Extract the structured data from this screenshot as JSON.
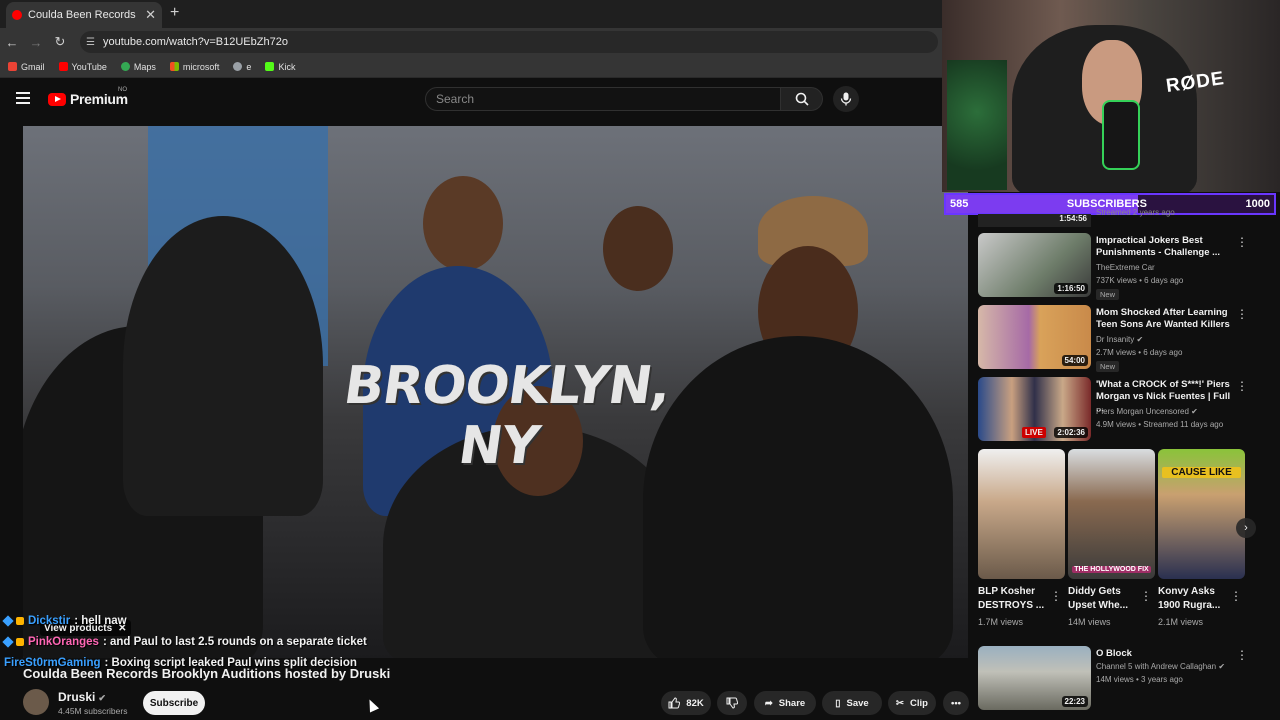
{
  "browser": {
    "tab_title": "Coulda Been Records Brook",
    "url": "youtube.com/watch?v=B12UEbZh72o",
    "bookmarks": [
      "Gmail",
      "YouTube",
      "Maps",
      "microsoft",
      "e",
      "Kick"
    ]
  },
  "header": {
    "logo_text": "Premium",
    "region": "NO",
    "search_placeholder": "Search"
  },
  "video": {
    "overlay_text": "BROOKLYN, NY",
    "title": "Coulda Been Records Brooklyn Auditions hosted by Druski",
    "channel": "Druski",
    "subscribers": "4.45M subscribers",
    "subscribe_label": "Subscribe",
    "likes": "82K",
    "share_label": "Share",
    "save_label": "Save",
    "clip_label": "Clip",
    "view_products_label": "View products"
  },
  "chat": [
    {
      "user": "Dickstir",
      "user_color": "#3aa0ff",
      "message": ": hell naw"
    },
    {
      "user": "PinkOranges",
      "user_color": "#ff66b4",
      "message": ": and Paul to last 2.5 rounds on a separate ticket"
    },
    {
      "user": "FireSt0rmGaming",
      "user_color": "#3aa0ff",
      "message": ": Boxing script leaked Paul wins split decision"
    }
  ],
  "stream": {
    "mic_brand": "RØDE",
    "goal_current": "585",
    "goal_label": "SUBSCRIBERS",
    "goal_target": "1000",
    "goal_fraction": 0.585
  },
  "sidebar": {
    "partial_duration": "1:54:56",
    "partial_meta": "Streamed 2 years ago",
    "videos": [
      {
        "title": "Impractical Jokers Best Punishments - Challenge ...",
        "channel": "TheExtreme Car",
        "meta": "737K views • 6 days ago",
        "badge": "New",
        "duration": "1:16:50"
      },
      {
        "title": "Mom Shocked After Learning Teen Sons Are Wanted Killers",
        "channel": "Dr Insanity",
        "meta": "2.7M views • 6 days ago",
        "badge": "New",
        "duration": "54:00"
      },
      {
        "title": "'What a CROCK of S***!' Piers Morgan vs Nick Fuentes | Full ...",
        "channel": "Piers Morgan Uncensored",
        "meta": "4.9M views • Streamed 11 days ago",
        "live": "LIVE",
        "duration": "2:02:36"
      }
    ],
    "shorts": [
      {
        "title": "BLP Kosher DESTROYS ...",
        "views": "1.7M views",
        "caption": ""
      },
      {
        "title": "Diddy Gets Upset Whe...",
        "views": "14M views",
        "caption": "THE HOLLYWOOD FIX"
      },
      {
        "title": "Konvy Asks 1900 Rugra...",
        "views": "2.1M views",
        "caption": "CAUSE LIKE"
      }
    ],
    "last_video": {
      "title": "O Block",
      "channel": "Channel 5 with Andrew Callaghan",
      "meta": "14M views • 3 years ago",
      "duration": "22:23"
    }
  }
}
